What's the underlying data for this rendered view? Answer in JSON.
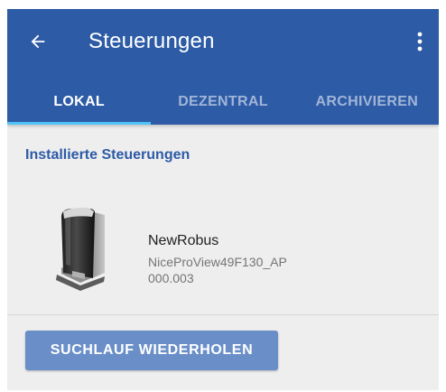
{
  "colors": {
    "appbar": "#2d5ba6",
    "tab_indicator": "#4fc3f7",
    "section_header": "#2d5ba6",
    "button": "#6a8fc8",
    "background": "#eeeeee"
  },
  "toolbar": {
    "back_icon": "arrow-left-icon",
    "title": "Steuerungen",
    "menu_icon": "more-vertical-icon"
  },
  "tabs": [
    {
      "label": "LOKAL",
      "active": true
    },
    {
      "label": "DEZENTRAL",
      "active": false
    },
    {
      "label": "ARCHIVIEREN",
      "active": false
    }
  ],
  "section": {
    "title": "Installierte Steuerungen"
  },
  "devices": [
    {
      "name": "NewRobus",
      "id": "NiceProView49F130_AP",
      "version": "000.003",
      "image": "gate-motor-icon"
    }
  ],
  "actions": {
    "repeat_scan_label": "SUCHLAUF WIEDERHOLEN"
  }
}
